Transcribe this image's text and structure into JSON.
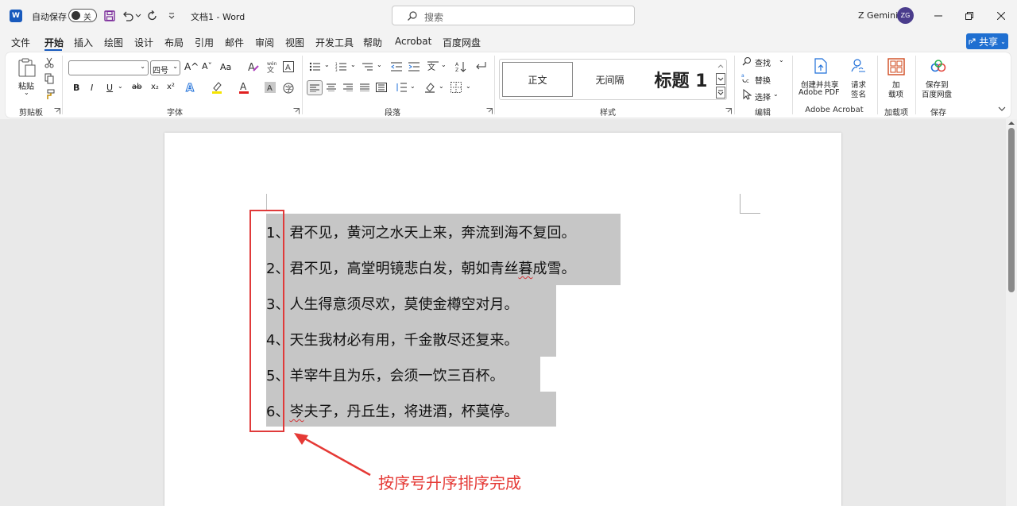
{
  "titlebar": {
    "autosave_label": "自动保存",
    "autosave_state": "关",
    "doc_title": "文档1 - Word",
    "search_placeholder": "搜索",
    "user_name": "Z Gemini",
    "avatar_initials": "ZG"
  },
  "menu": {
    "tabs": [
      "文件",
      "开始",
      "插入",
      "绘图",
      "设计",
      "布局",
      "引用",
      "邮件",
      "审阅",
      "视图",
      "开发工具",
      "帮助",
      "Acrobat",
      "百度网盘"
    ],
    "active": "开始",
    "share_label": "共享"
  },
  "ribbon": {
    "clipboard": {
      "paste_label": "粘贴",
      "group_label": "剪贴板"
    },
    "font": {
      "font_name_value": "",
      "font_size_value": "四号",
      "grow_label": "A^",
      "shrink_label": "Aˇ",
      "case_label": "Aa",
      "bold_label": "B",
      "italic_label": "I",
      "underline_label": "U",
      "strike_label": "ab",
      "sub_label": "x₂",
      "sup_label": "x²",
      "group_label": "字体"
    },
    "paragraph": {
      "group_label": "段落"
    },
    "styles": {
      "items": [
        "正文",
        "无间隔",
        "标题 1"
      ],
      "group_label": "样式"
    },
    "editing": {
      "find_label": "查找",
      "replace_label": "替换",
      "select_label": "选择",
      "group_label": "编辑"
    },
    "acrobat": {
      "create_share_line1": "创建并共享",
      "create_share_line2": "Adobe PDF",
      "request_sign_line1": "请求",
      "request_sign_line2": "签名",
      "group_label": "Adobe Acrobat"
    },
    "addins": {
      "btn_line1": "加",
      "btn_line2": "载项",
      "group_label": "加载项"
    },
    "save": {
      "btn_line1": "保存到",
      "btn_line2": "百度网盘",
      "group_label": "保存"
    }
  },
  "document": {
    "lines": [
      {
        "num": "1",
        "text": "、君不见，黄河之水天上来，奔流到海不复回。"
      },
      {
        "num": "2",
        "text": "、君不见，高堂明镜悲白发，朝如青丝暮成雪。"
      },
      {
        "num": "3",
        "text": "、人生得意须尽欢，莫使金樽空对月。"
      },
      {
        "num": "4",
        "text": "、天生我材必有用，千金散尽还复来。"
      },
      {
        "num": "5",
        "text": "、羊宰牛且为乐，会须一饮三百杯。"
      },
      {
        "num": "6",
        "text": "、岑夫子，丹丘生，将进酒，杯莫停。"
      }
    ],
    "annotation": "按序号升序排序完成"
  },
  "colors": {
    "accent": "#185abd",
    "selection": "#c6c6c6",
    "annotation_red": "#e53935"
  }
}
